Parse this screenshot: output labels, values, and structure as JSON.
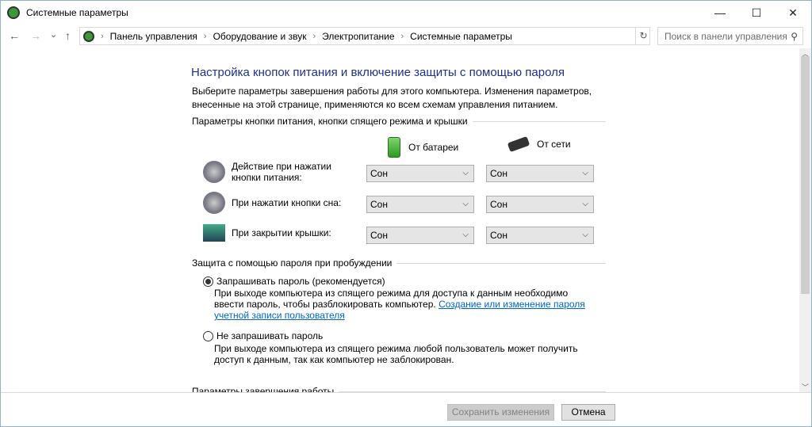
{
  "window": {
    "title": "Системные параметры",
    "minimize": "—",
    "maximize": "☐",
    "close": "✕"
  },
  "address": {
    "back": "←",
    "forward": "→",
    "recent": "⌄",
    "up": "↑",
    "crumbs": [
      "Панель управления",
      "Оборудование и звук",
      "Электропитание",
      "Системные параметры"
    ],
    "refresh": "↻",
    "search_placeholder": "Поиск в панели управления",
    "search_icon": "⚲"
  },
  "main": {
    "title": "Настройка кнопок питания и включение защиты с помощью пароля",
    "description": "Выберите параметры завершения работы для этого компьютера. Изменения параметров, внесенные на этой странице, применяются ко всем схемам управления питанием.",
    "buttons_group": "Параметры кнопки питания, кнопки спящего режима и крышки",
    "col_battery": "От батареи",
    "col_ac": "От сети",
    "rows": [
      {
        "label": "Действие при нажатии кнопки питания:",
        "battery": "Сон",
        "ac": "Сон"
      },
      {
        "label": "При нажатии кнопки сна:",
        "battery": "Сон",
        "ac": "Сон"
      },
      {
        "label": "При закрытии крышки:",
        "battery": "Сон",
        "ac": "Сон"
      }
    ],
    "password_group": "Защита с помощью пароля при пробуждении",
    "opt1_label": "Запрашивать пароль (рекомендуется)",
    "opt1_selected": true,
    "opt1_desc": "При выходе компьютера из спящего режима для доступа к данным необходимо ввести пароль, чтобы разблокировать компьютер. ",
    "opt1_link": "Создание или изменение пароля учетной записи пользователя",
    "opt2_label": "Не запрашивать пароль",
    "opt2_selected": false,
    "opt2_desc": "При выходе компьютера из спящего режима любой пользователь может получить доступ к данным, так как компьютер не заблокирован.",
    "shutdown_group": "Параметры завершения работы"
  },
  "footer": {
    "save": "Сохранить изменения",
    "cancel": "Отмена"
  }
}
